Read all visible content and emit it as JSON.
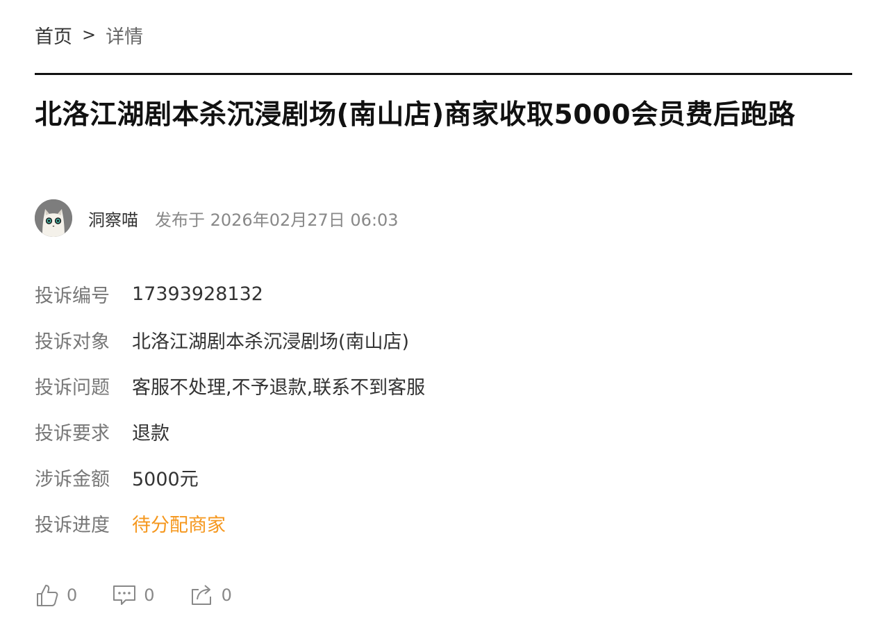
{
  "breadcrumb": {
    "home": "首页",
    "separator": ">",
    "current": "详情"
  },
  "article": {
    "title": "北洛江湖剧本杀沉浸剧场(南山店)商家收取5000会员费后跑路",
    "author": "洞察喵",
    "published": "发布于 2026年02月27日 06:03"
  },
  "complaint": {
    "rows": [
      {
        "label": "投诉编号",
        "value": "17393928132"
      },
      {
        "label": "投诉对象",
        "value": "北洛江湖剧本杀沉浸剧场(南山店)"
      },
      {
        "label": "投诉问题",
        "value": "客服不处理,不予退款,联系不到客服"
      },
      {
        "label": "投诉要求",
        "value": "退款"
      },
      {
        "label": "涉诉金额",
        "value": "5000元"
      },
      {
        "label": "投诉进度",
        "value": "待分配商家"
      }
    ]
  },
  "actions": {
    "like_count": "0",
    "comment_count": "0",
    "share_count": "0"
  },
  "colors": {
    "status": "#f5971d",
    "divider": "#111111",
    "label": "#777777"
  },
  "icons": {
    "avatar": "cat-avatar",
    "like": "thumbs-up-icon",
    "comment": "comment-icon",
    "share": "share-icon"
  }
}
